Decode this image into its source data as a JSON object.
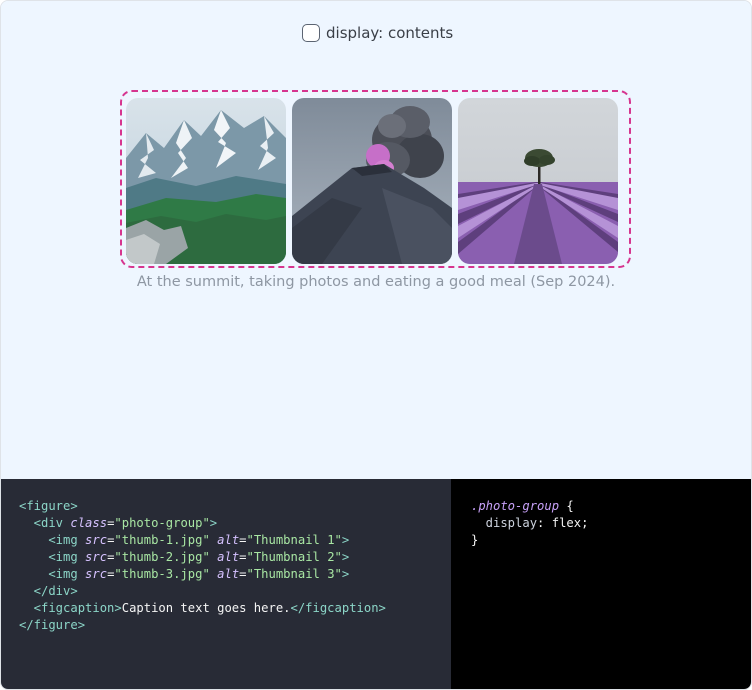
{
  "toggle": {
    "label": "display: contents",
    "checked": false
  },
  "thumbnails": [
    {
      "alt": "Thumbnail 1",
      "subject": "mountain range"
    },
    {
      "alt": "Thumbnail 2",
      "subject": "volcano with ash plume"
    },
    {
      "alt": "Thumbnail 3",
      "subject": "lavender field with tree"
    }
  ],
  "caption": "At the summit, taking photos and eating a good meal (Sep 2024).",
  "code": {
    "html_lines": [
      [
        "<figure>"
      ],
      [
        "  <div ",
        "class",
        "=",
        "\"photo-group\"",
        ">"
      ],
      [
        "    <img ",
        "src",
        "=",
        "\"thumb-1.jpg\"",
        " ",
        "alt",
        "=",
        "\"Thumbnail 1\"",
        ">"
      ],
      [
        "    <img ",
        "src",
        "=",
        "\"thumb-2.jpg\"",
        " ",
        "alt",
        "=",
        "\"Thumbnail 2\"",
        ">"
      ],
      [
        "    <img ",
        "src",
        "=",
        "\"thumb-3.jpg\"",
        " ",
        "alt",
        "=",
        "\"Thumbnail 3\"",
        ">"
      ],
      [
        "  </div>"
      ],
      [
        "  <figcaption>",
        "Caption text goes here.",
        "</figcaption>"
      ],
      [
        "</figure>"
      ]
    ],
    "css_selector": ".photo-group",
    "css_open": " {",
    "css_property": "  display",
    "css_colon": ": ",
    "css_value": "flex",
    "css_semicolon": ";",
    "css_close": "}"
  },
  "colors": {
    "stage_bg": "#eef6ff",
    "outline": "#d6358f",
    "html_panel_bg": "#282b36",
    "css_panel_bg": "#000000"
  }
}
